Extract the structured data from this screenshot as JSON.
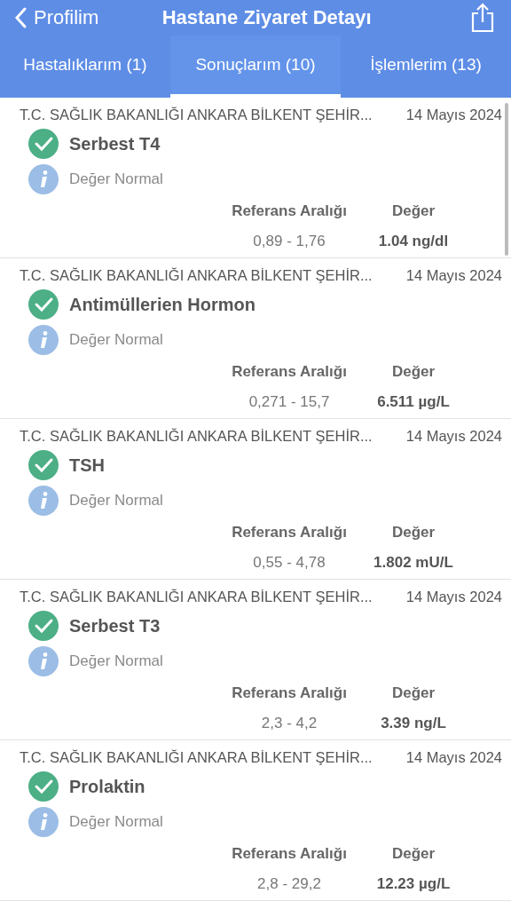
{
  "nav": {
    "back_label": "Profilim",
    "title": "Hastane Ziyaret Detayı"
  },
  "tabs": [
    {
      "label": "Hastalıklarım (1)",
      "selected": false
    },
    {
      "label": "Sonuçlarım (10)",
      "selected": true
    },
    {
      "label": "İşlemlerim (13)",
      "selected": false
    }
  ],
  "results": [
    {
      "institution": "T.C. SAĞLIK BAKANLIĞI ANKARA BİLKENT ŞEHİR...",
      "date": "14 Mayıs 2024",
      "test": "Serbest T4",
      "normal": true,
      "note": "Değer Normal",
      "range_label": "Referans Aralığı",
      "value_label": "Değer",
      "range": "0,89 - 1,76",
      "value": "1.04 ng/dl"
    },
    {
      "institution": "T.C. SAĞLIK BAKANLIĞI ANKARA BİLKENT ŞEHİR...",
      "date": "14 Mayıs 2024",
      "test": "Antimüllerien Hormon",
      "normal": true,
      "note": "Değer Normal",
      "range_label": "Referans Aralığı",
      "value_label": "Değer",
      "range": "0,271 - 15,7",
      "value": "6.511 µg/L"
    },
    {
      "institution": "T.C. SAĞLIK BAKANLIĞI ANKARA BİLKENT ŞEHİR...",
      "date": "14 Mayıs 2024",
      "test": "TSH",
      "normal": true,
      "note": "Değer Normal",
      "range_label": "Referans Aralığı",
      "value_label": "Değer",
      "range": "0,55 - 4,78",
      "value": "1.802 mU/L"
    },
    {
      "institution": "T.C. SAĞLIK BAKANLIĞI ANKARA BİLKENT ŞEHİR...",
      "date": "14 Mayıs 2024",
      "test": "Serbest T3",
      "normal": true,
      "note": "Değer Normal",
      "range_label": "Referans Aralığı",
      "value_label": "Değer",
      "range": "2,3 - 4,2",
      "value": "3.39 ng/L"
    },
    {
      "institution": "T.C. SAĞLIK BAKANLIĞI ANKARA BİLKENT ŞEHİR...",
      "date": "14 Mayıs 2024",
      "test": "Prolaktin",
      "normal": true,
      "note": "Değer Normal",
      "range_label": "Referans Aralığı",
      "value_label": "Değer",
      "range": "2,8 - 29,2",
      "value": "12.23 µg/L"
    }
  ]
}
